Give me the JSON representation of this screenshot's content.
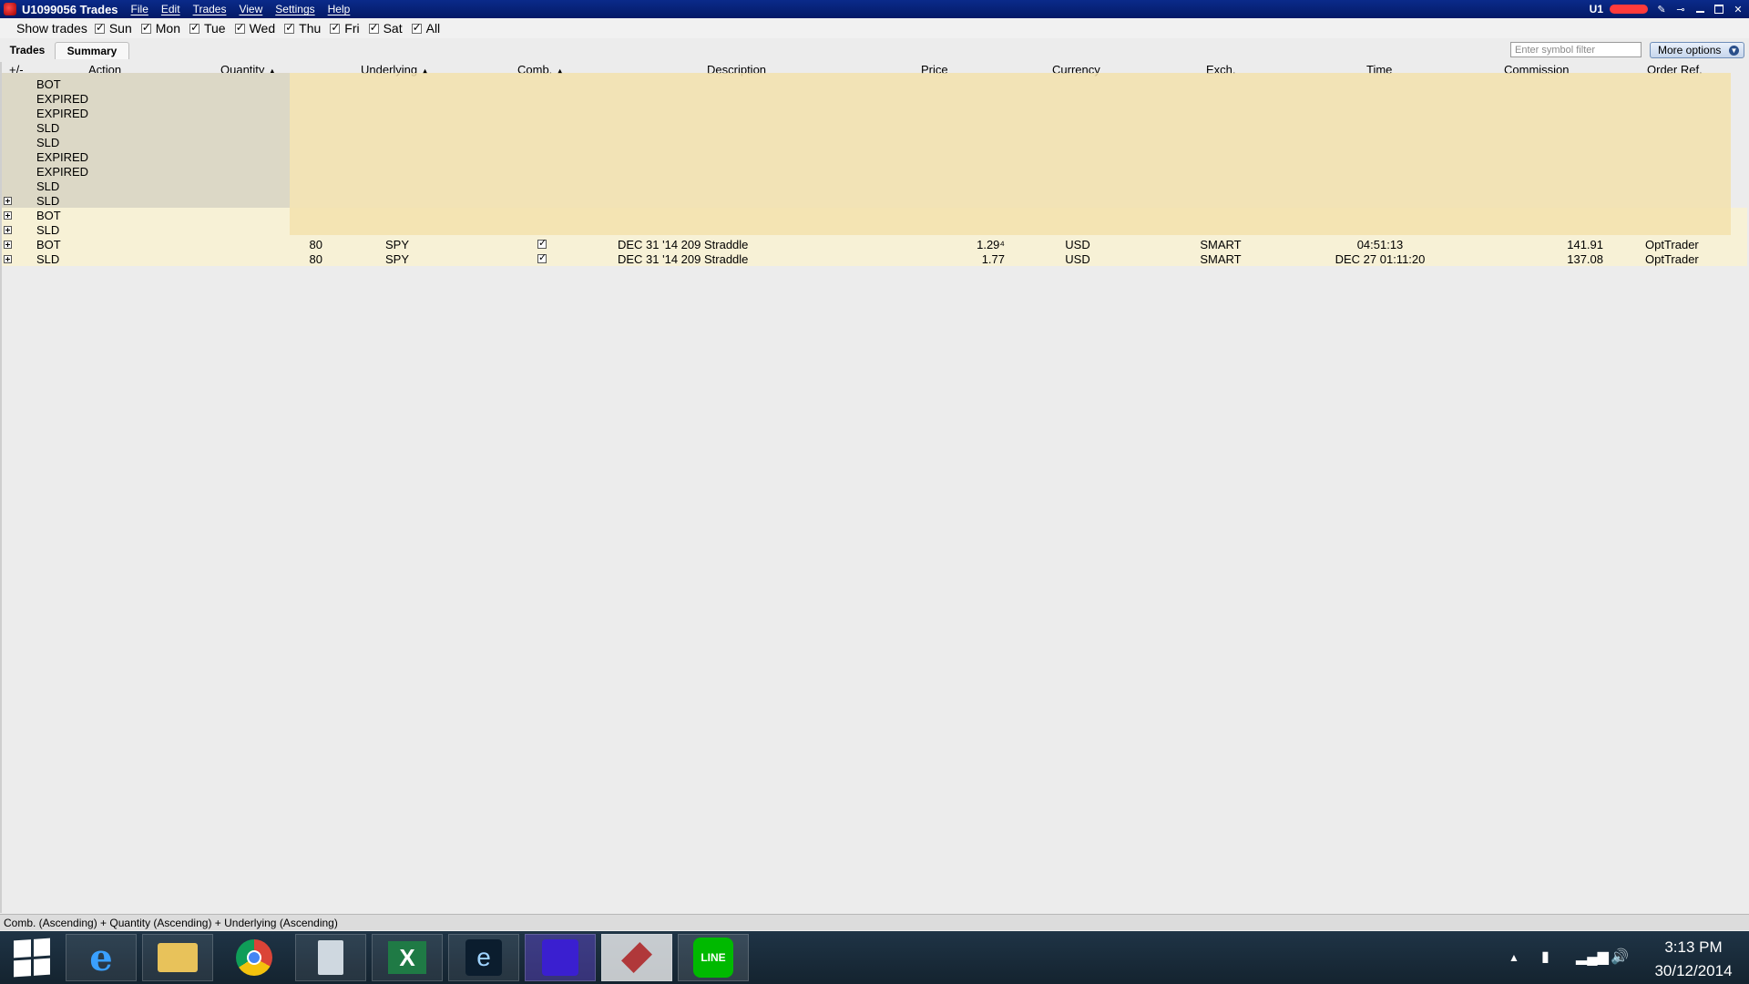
{
  "window": {
    "title": "U1099056 Trades",
    "account_label": "U1",
    "menu": [
      "File",
      "Edit",
      "Trades",
      "View",
      "Settings",
      "Help"
    ]
  },
  "show_trades": {
    "label": "Show trades",
    "days": [
      {
        "label": "Sun",
        "checked": true
      },
      {
        "label": "Mon",
        "checked": true
      },
      {
        "label": "Tue",
        "checked": true
      },
      {
        "label": "Wed",
        "checked": true
      },
      {
        "label": "Thu",
        "checked": true
      },
      {
        "label": "Fri",
        "checked": true
      },
      {
        "label": "Sat",
        "checked": true
      },
      {
        "label": "All",
        "checked": true
      }
    ]
  },
  "tabs": [
    "Trades",
    "Summary"
  ],
  "active_tab": "Summary",
  "symbol_filter": {
    "placeholder": "Enter symbol filter",
    "value": ""
  },
  "more_options_label": "More options",
  "columns": {
    "expand": "+/-",
    "action": "Action",
    "quantity": "Quantity",
    "underlying": "Underlying",
    "comb": "Comb.",
    "description": "Description",
    "price": "Price",
    "currency": "Currency",
    "exch": "Exch.",
    "time": "Time",
    "commission": "Commission",
    "order_ref": "Order Ref."
  },
  "redacted_rows": [
    {
      "action": "BOT",
      "expandable": false
    },
    {
      "action": "EXPIRED",
      "expandable": false
    },
    {
      "action": "EXPIRED",
      "expandable": false
    },
    {
      "action": "SLD",
      "expandable": false
    },
    {
      "action": "SLD",
      "expandable": false
    },
    {
      "action": "EXPIRED",
      "expandable": false
    },
    {
      "action": "EXPIRED",
      "expandable": false
    },
    {
      "action": "SLD",
      "expandable": false
    },
    {
      "action": "SLD",
      "expandable": true
    },
    {
      "action": "BOT",
      "expandable": true
    },
    {
      "action": "SLD",
      "expandable": true
    }
  ],
  "rows": [
    {
      "action": "BOT",
      "quantity": "80",
      "underlying": "SPY",
      "comb": true,
      "description": "DEC 31 '14  209 Straddle",
      "price": "1.29⁴",
      "currency": "USD",
      "exch": "SMART",
      "time": "04:51:13",
      "commission": "141.91",
      "order_ref": "OptTrader"
    },
    {
      "action": "SLD",
      "quantity": "80",
      "underlying": "SPY",
      "comb": true,
      "description": "DEC 31 '14  209 Straddle",
      "price": "1.77",
      "currency": "USD",
      "exch": "SMART",
      "time": "DEC 27 01:11:20",
      "commission": "137.08",
      "order_ref": "OptTrader"
    }
  ],
  "status_bar": "Comb. (Ascending)  +  Quantity (Ascending)  +  Underlying (Ascending)",
  "taskbar": {
    "apps": [
      "internet-explorer",
      "file-explorer",
      "chrome",
      "calculator",
      "excel",
      "ebook-reader",
      "media-app",
      "trading-app",
      "line"
    ],
    "clock_time": "3:13 PM",
    "clock_date": "30/12/2014"
  }
}
